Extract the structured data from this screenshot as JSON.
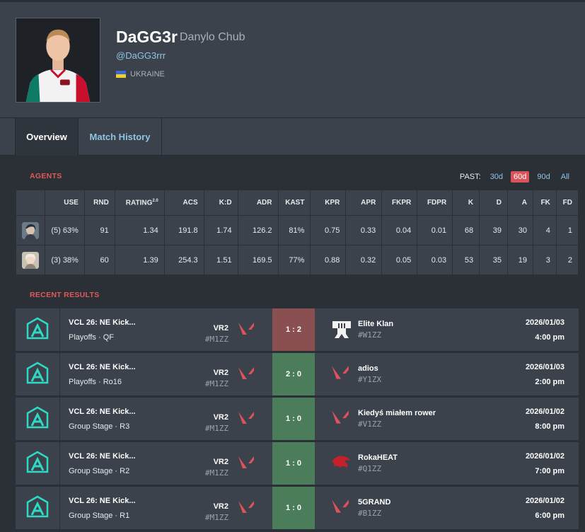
{
  "player": {
    "name": "DaGG3r",
    "real_name": "Danylo Chub",
    "handle": "@DaGG3rrr",
    "country": "UKRAINE"
  },
  "tabs": [
    {
      "label": "Overview",
      "active": true
    },
    {
      "label": "Match History",
      "active": false
    }
  ],
  "agents_section": {
    "label": "AGENTS",
    "past_label": "PAST:",
    "filters": [
      "30d",
      "60d",
      "90d",
      "All"
    ],
    "active_filter": "60d",
    "columns": [
      "USE",
      "RND",
      "RATING",
      "ACS",
      "K:D",
      "ADR",
      "KAST",
      "KPR",
      "APR",
      "FKPR",
      "FDPR",
      "K",
      "D",
      "A",
      "FK",
      "FD"
    ],
    "rating_sup": "2.0",
    "rows": [
      {
        "icon": "agent-icon-1",
        "use": "(5) 63%",
        "rnd": "91",
        "rating": "1.34",
        "acs": "191.8",
        "kd": "1.74",
        "adr": "126.2",
        "kast": "81%",
        "kpr": "0.75",
        "apr": "0.33",
        "fkpr": "0.04",
        "fdpr": "0.01",
        "k": "68",
        "d": "39",
        "a": "30",
        "fk": "4",
        "fd": "1"
      },
      {
        "icon": "agent-icon-2",
        "use": "(3) 38%",
        "rnd": "60",
        "rating": "1.39",
        "acs": "254.3",
        "kd": "1.51",
        "adr": "169.5",
        "kast": "77%",
        "kpr": "0.88",
        "apr": "0.32",
        "fkpr": "0.05",
        "fdpr": "0.03",
        "k": "53",
        "d": "35",
        "a": "19",
        "fk": "3",
        "fd": "2"
      }
    ]
  },
  "results_section": {
    "label": "RECENT RESULTS",
    "matches": [
      {
        "event": "VCL 26: NE Kick...",
        "stage": "Playoffs · QF",
        "team_left": "VR2",
        "team_left_tag": "#M1ZZ",
        "score": "1 : 2",
        "result": "loss",
        "team_right": "Elite Klan",
        "team_right_tag": "#W1ZZ",
        "date": "2026/01/03",
        "time": "4:00 pm"
      },
      {
        "event": "VCL 26: NE Kick...",
        "stage": "Playoffs · Ro16",
        "team_left": "VR2",
        "team_left_tag": "#M1ZZ",
        "score": "2 : 0",
        "result": "win",
        "team_right": "adios",
        "team_right_tag": "#Y1ZX",
        "date": "2026/01/03",
        "time": "2:00 pm"
      },
      {
        "event": "VCL 26: NE Kick...",
        "stage": "Group Stage · R3",
        "team_left": "VR2",
        "team_left_tag": "#M1ZZ",
        "score": "1 : 0",
        "result": "win",
        "team_right": "Kiedyś miałem rower",
        "team_right_tag": "#V1ZZ",
        "date": "2026/01/02",
        "time": "8:00 pm"
      },
      {
        "event": "VCL 26: NE Kick...",
        "stage": "Group Stage · R2",
        "team_left": "VR2",
        "team_left_tag": "#M1ZZ",
        "score": "1 : 0",
        "result": "win",
        "team_right": "RokaHEAT",
        "team_right_tag": "#Q1ZZ",
        "date": "2026/01/02",
        "time": "7:00 pm"
      },
      {
        "event": "VCL 26: NE Kick...",
        "stage": "Group Stage · R1",
        "team_left": "VR2",
        "team_left_tag": "#M1ZZ",
        "score": "1 : 0",
        "result": "win",
        "team_right": "5GRAND",
        "team_right_tag": "#B1ZZ",
        "date": "2026/01/02",
        "time": "6:00 pm"
      }
    ]
  },
  "colors": {
    "accent_red": "#e05a5a",
    "link_blue": "#8fc4e4",
    "win": "#4c7d5a",
    "loss": "#8a4f50"
  }
}
